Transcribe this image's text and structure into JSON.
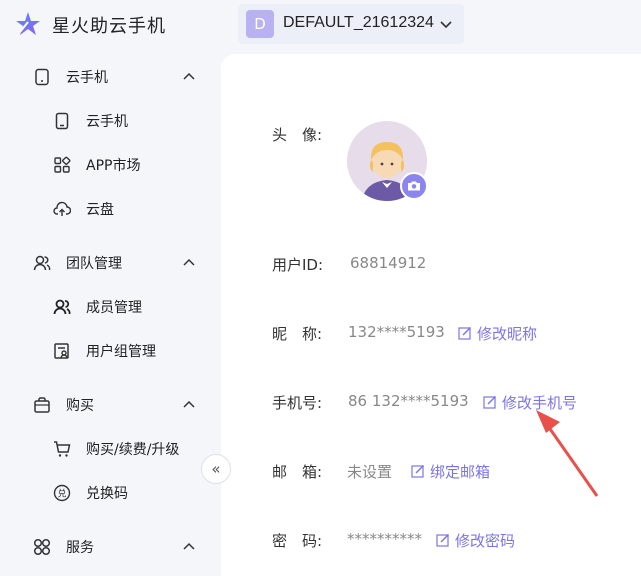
{
  "header": {
    "app_title": "星火助云手机",
    "account_initial": "D",
    "account_name": "DEFAULT_21612324"
  },
  "sidebar": {
    "groups": [
      {
        "label": "云手机",
        "icon": "phone-icon",
        "items": [
          {
            "label": "云手机",
            "icon": "phone-icon"
          },
          {
            "label": "APP市场",
            "icon": "apps-grid-icon"
          },
          {
            "label": "云盘",
            "icon": "cloud-upload-icon"
          }
        ]
      },
      {
        "label": "团队管理",
        "icon": "team-icon",
        "items": [
          {
            "label": "成员管理",
            "icon": "members-icon"
          },
          {
            "label": "用户组管理",
            "icon": "user-group-icon"
          }
        ]
      },
      {
        "label": "购买",
        "icon": "shopping-bag-icon",
        "items": [
          {
            "label": "购买/续费/升级",
            "icon": "cart-icon"
          },
          {
            "label": "兑换码",
            "icon": "redeem-icon"
          }
        ]
      },
      {
        "label": "服务",
        "icon": "service-icon",
        "items": []
      }
    ],
    "collapse_glyph": "«"
  },
  "profile": {
    "avatar_label": "头　像:",
    "user_id_label": "用户ID:",
    "user_id_value": "68814912",
    "nickname_label": "昵　称:",
    "nickname_value": "132****5193",
    "nickname_action": "修改昵称",
    "phone_label": "手机号:",
    "phone_value": "86 132****5193",
    "phone_action": "修改手机号",
    "email_label": "邮　箱:",
    "email_value": "未设置",
    "email_action": "绑定邮箱",
    "password_label": "密　码:",
    "password_value": "**********",
    "password_action": "修改密码"
  },
  "colors": {
    "accent": "#7b74e6",
    "annotation_arrow": "#e8504a",
    "sidebar_bg": "#f5f6fa"
  }
}
